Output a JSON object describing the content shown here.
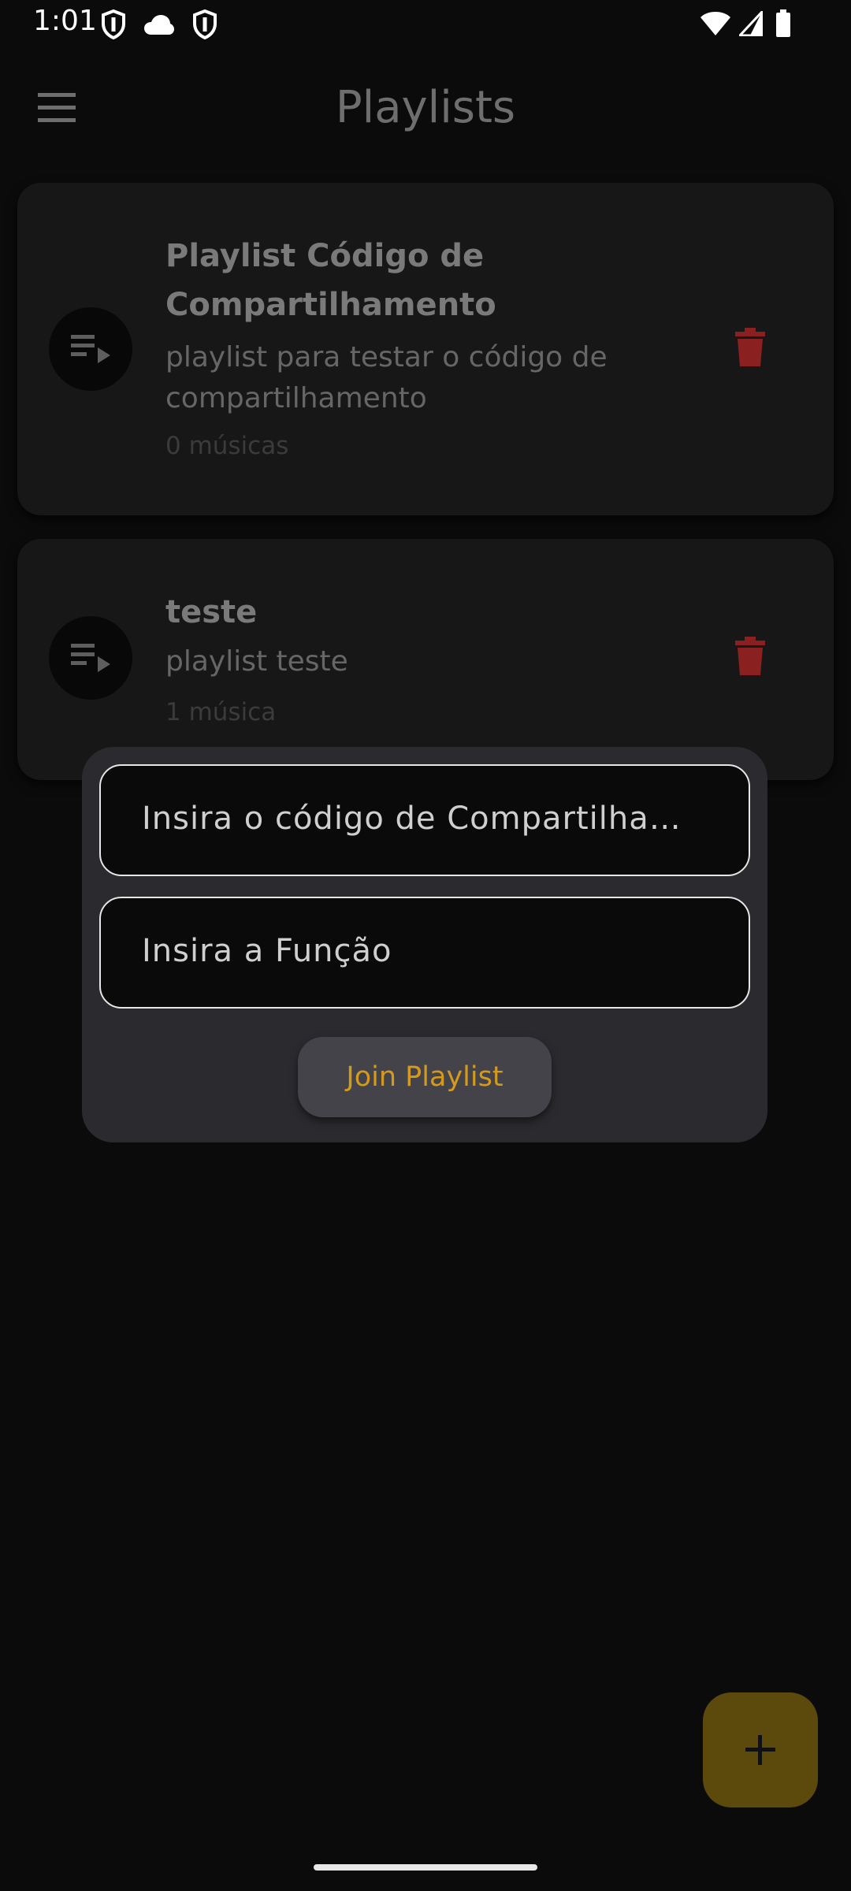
{
  "status_bar": {
    "time": "1:01"
  },
  "app_bar": {
    "title": "Playlists"
  },
  "playlists": [
    {
      "title": "Playlist Código de Compartilhamento",
      "description": "playlist para testar o código de compartilhamento",
      "count": "0 músicas"
    },
    {
      "title": "teste",
      "description": "playlist teste",
      "count": "1 música"
    }
  ],
  "dialog": {
    "share_code_placeholder": "Insira o código de Compartilhamento",
    "role_placeholder": "Insira a Função",
    "join_label": "Join Playlist"
  },
  "colors": {
    "accent": "#d49a1e",
    "delete": "#8a2020",
    "fab": "#5c4a0d"
  },
  "icons": {
    "menu": "menu-icon",
    "playlist": "playlist-play-icon",
    "delete": "trash-icon",
    "add": "plus-icon"
  }
}
